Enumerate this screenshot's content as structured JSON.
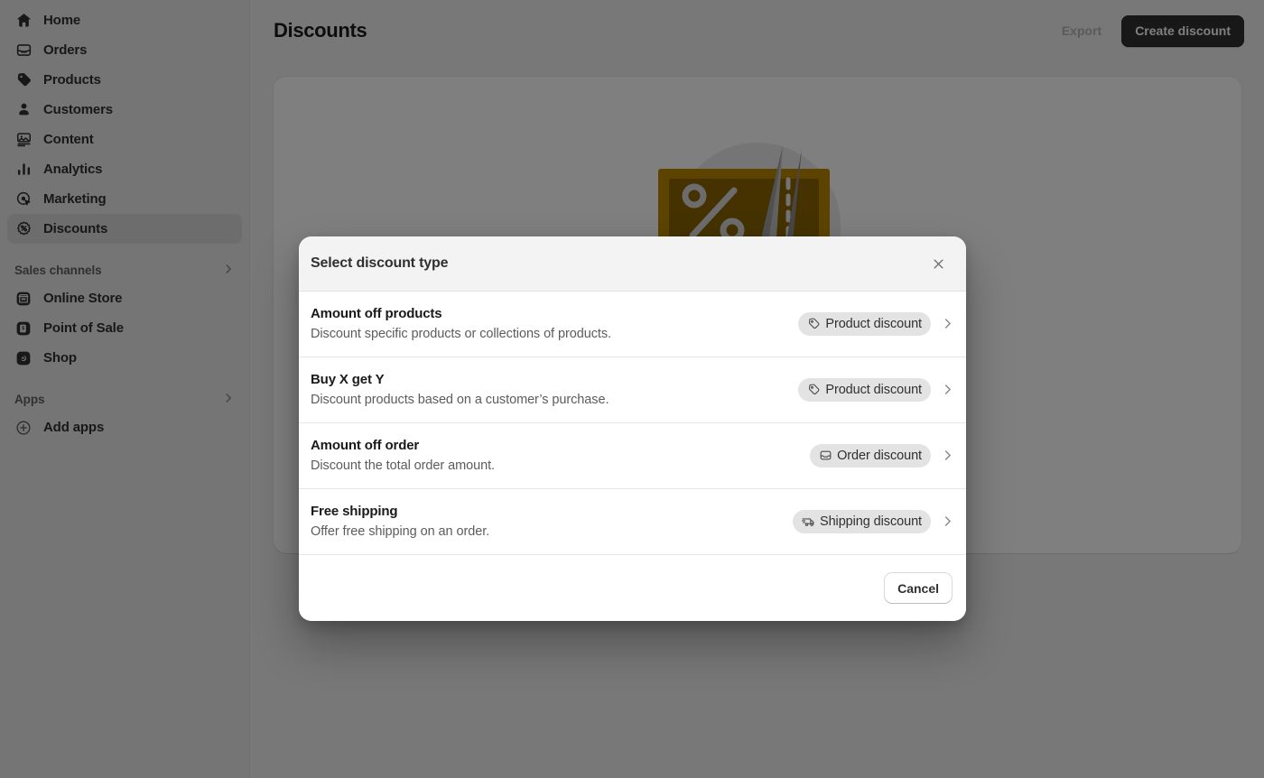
{
  "sidebar": {
    "items": [
      {
        "label": "Home",
        "icon": "home-icon",
        "active": false
      },
      {
        "label": "Orders",
        "icon": "orders-icon",
        "active": false
      },
      {
        "label": "Products",
        "icon": "tag-icon",
        "active": false
      },
      {
        "label": "Customers",
        "icon": "person-icon",
        "active": false
      },
      {
        "label": "Content",
        "icon": "content-icon",
        "active": false
      },
      {
        "label": "Analytics",
        "icon": "analytics-icon",
        "active": false
      },
      {
        "label": "Marketing",
        "icon": "marketing-icon",
        "active": false
      },
      {
        "label": "Discounts",
        "icon": "discount-icon",
        "active": true
      }
    ],
    "sales_channels": {
      "heading": "Sales channels",
      "items": [
        {
          "label": "Online Store",
          "icon": "store-icon"
        },
        {
          "label": "Point of Sale",
          "icon": "pos-icon"
        },
        {
          "label": "Shop",
          "icon": "shop-icon"
        }
      ]
    },
    "apps": {
      "heading": "Apps",
      "items": [
        {
          "label": "Add apps",
          "icon": "plus-circle-icon"
        }
      ]
    }
  },
  "header": {
    "title": "Discounts",
    "export_label": "Export",
    "create_label": "Create discount"
  },
  "modal": {
    "title": "Select discount type",
    "close_icon": "close-icon",
    "cancel_label": "Cancel",
    "options": [
      {
        "title": "Amount off products",
        "description": "Discount specific products or collections of products.",
        "badge": "Product discount",
        "badge_icon": "price-tag-icon"
      },
      {
        "title": "Buy X get Y",
        "description": "Discount products based on a customer’s purchase.",
        "badge": "Product discount",
        "badge_icon": "price-tag-icon"
      },
      {
        "title": "Amount off order",
        "description": "Discount the total order amount.",
        "badge": "Order discount",
        "badge_icon": "order-box-icon"
      },
      {
        "title": "Free shipping",
        "description": "Offer free shipping on an order.",
        "badge": "Shipping discount",
        "badge_icon": "delivery-truck-icon"
      }
    ]
  },
  "empty_state": {
    "illustration": "discount-coupon-scissors-illustration",
    "coupon_color": "#b98900",
    "coupon_inner_color": "#8a6500"
  },
  "colors": {
    "sidebar_bg": "#ebebeb",
    "page_bg": "#f1f1f1",
    "primary_button": "#303030",
    "badge_bg": "#e3e3e3",
    "scrim": "rgba(0,0,0,0.5)"
  }
}
